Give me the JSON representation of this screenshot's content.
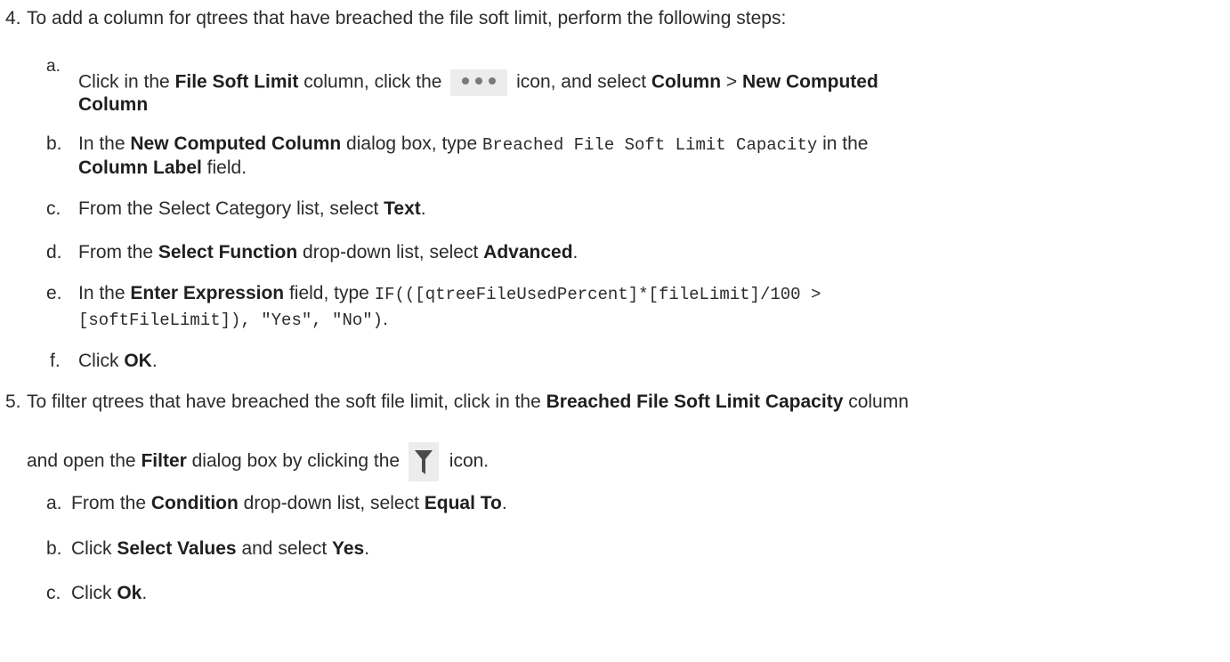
{
  "step4": {
    "number": "4.",
    "intro": "To add a column for qtrees that have breached the file soft limit, perform the following steps:",
    "a": {
      "letter": "a.",
      "t1": "Click in the ",
      "b1": "File Soft Limit",
      "t2": " column, click the ",
      "icon": "more-dots-icon",
      "t3": " icon, and select ",
      "b2": "Column",
      "t4": " > ",
      "b3": "New Computed",
      "b4": "Column"
    },
    "b": {
      "letter": "b.",
      "t1": "In the ",
      "b1": "New Computed Column",
      "t2": " dialog box, type ",
      "code1": "Breached File Soft Limit Capacity",
      "t3": " in the",
      "b2": "Column Label",
      "t4": " field."
    },
    "c": {
      "letter": "c.",
      "t1": "From the Select Category list, select ",
      "b1": "Text",
      "t2": "."
    },
    "d": {
      "letter": "d.",
      "t1": "From the ",
      "b1": "Select Function",
      "t2": " drop-down list, select ",
      "b2": "Advanced",
      "t3": "."
    },
    "e": {
      "letter": "e.",
      "t1": "In the ",
      "b1": "Enter Expression",
      "t2": " field, type ",
      "code1": "IF(([qtreeFileUsedPercent]*[fileLimit]/100 >",
      "code2": "[softFileLimit]), \"Yes\", \"No\")",
      "t3": "."
    },
    "f": {
      "letter": "f.",
      "t1": "Click ",
      "b1": "OK",
      "t2": "."
    }
  },
  "step5": {
    "number": "5.",
    "t1": "To filter qtrees that have breached the soft file limit, click in the ",
    "b1": "Breached File Soft Limit Capacity",
    "t2": " column",
    "t3": "and open the ",
    "b2": "Filter",
    "t4": " dialog box by clicking the ",
    "icon": "filter-funnel-icon",
    "t5": " icon.",
    "a": {
      "letter": "a.",
      "t1": "From the ",
      "b1": "Condition",
      "t2": " drop-down list, select ",
      "b2": "Equal To",
      "t3": "."
    },
    "b": {
      "letter": "b.",
      "t1": "Click ",
      "b1": "Select Values",
      "t2": " and select ",
      "b2": "Yes",
      "t3": "."
    },
    "c": {
      "letter": "c.",
      "t1": "Click ",
      "b1": "Ok",
      "t2": "."
    }
  }
}
